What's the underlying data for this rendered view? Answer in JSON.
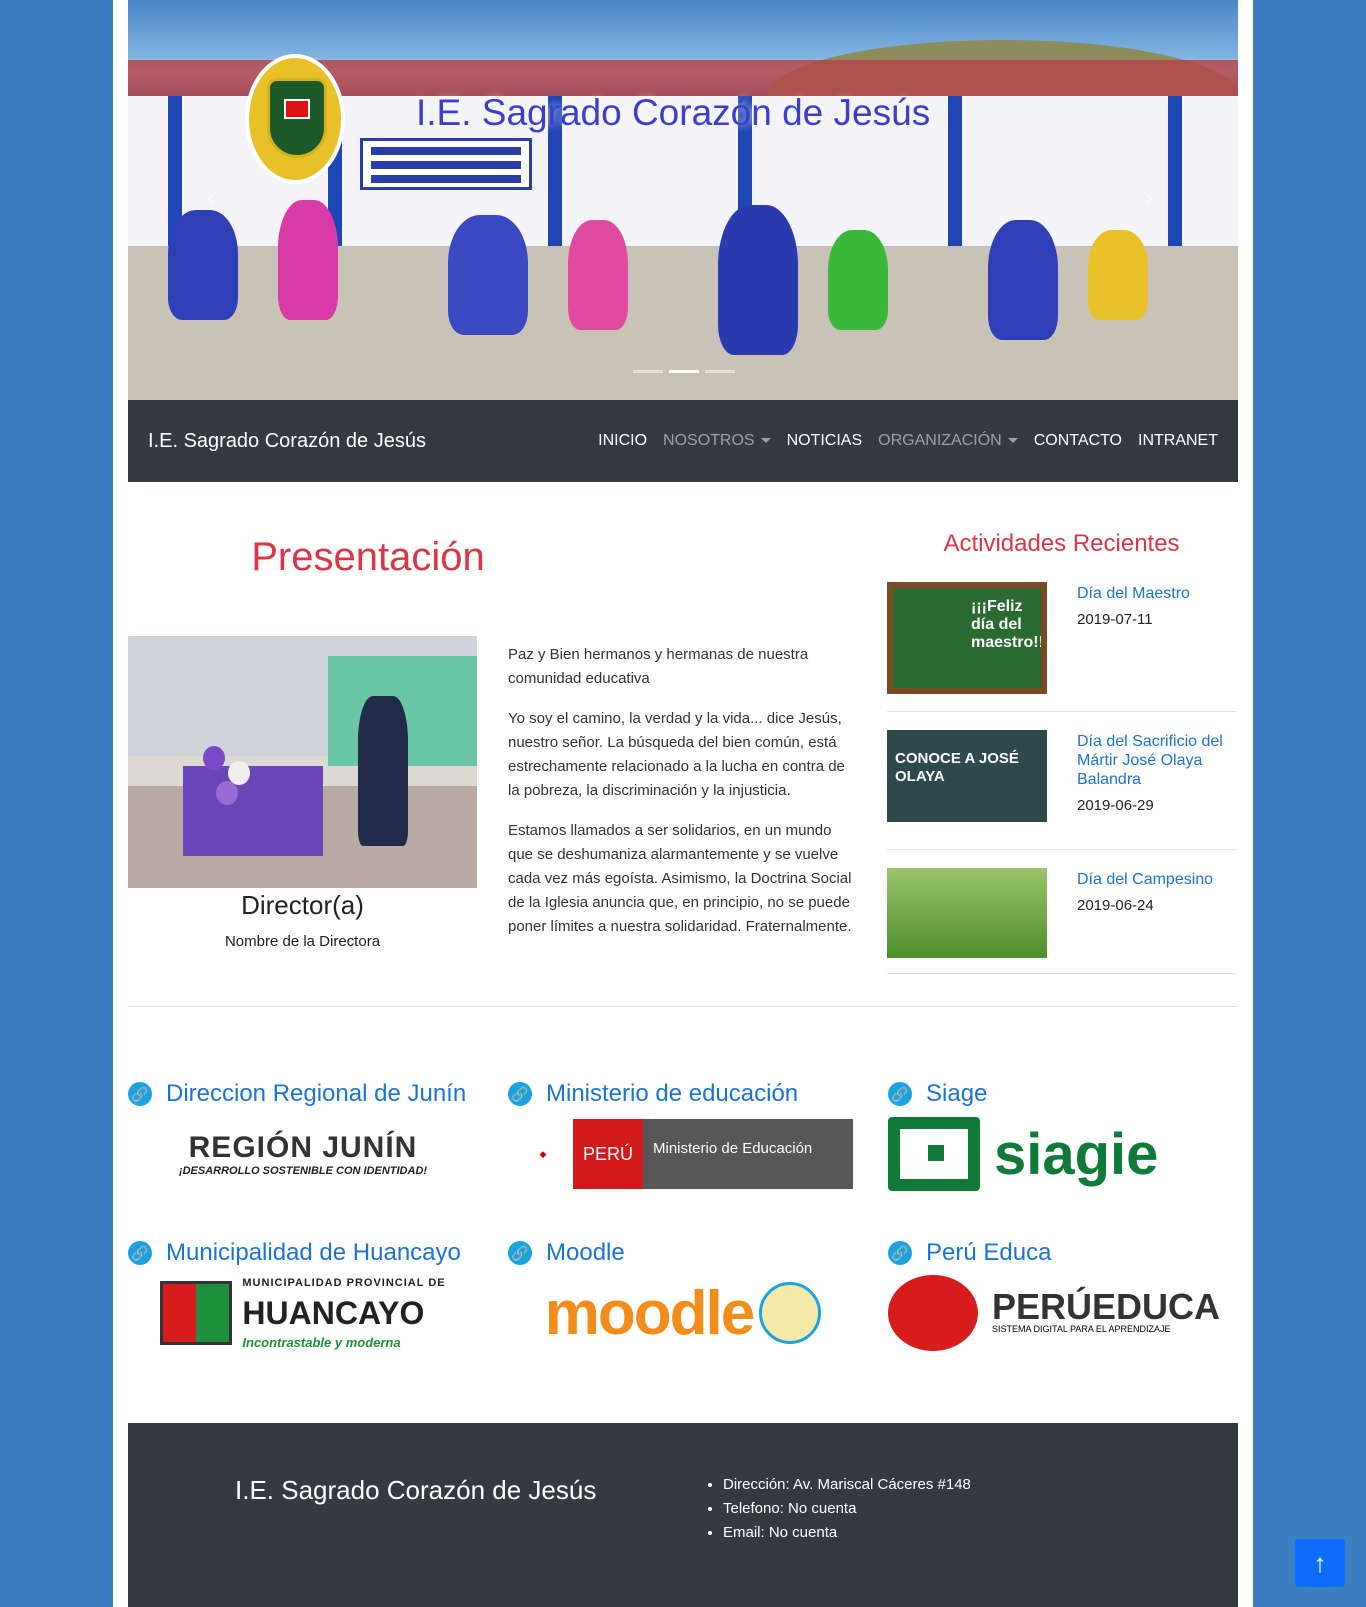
{
  "hero": {
    "title": "I.E. Sagrado Corazón de Jesús",
    "prev": "‹",
    "next": "›",
    "active_slide": 2,
    "slide_count": 3
  },
  "navbar": {
    "brand": "I.E. Sagrado Corazón de Jesús",
    "items": [
      {
        "label": "INICIO"
      },
      {
        "label": "NOSOTROS"
      },
      {
        "label": "NOTICIAS"
      },
      {
        "label": "ORGANIZACIÓN"
      },
      {
        "label": "CONTACTO"
      },
      {
        "label": "INTRANET"
      }
    ]
  },
  "presentation": {
    "title": "Presentación",
    "director_title": "Director(a)",
    "director_name": "Nombre de la Directora",
    "paragraphs": [
      "Paz y Bien hermanos y hermanas de nuestra comunidad educativa",
      "Yo soy el camino, la verdad y la vida... dice Jesús, nuestro señor. La búsqueda del bien común, está estrechamente relacionado a la lucha en contra de la pobreza, la discriminación y la injusticia.",
      "Estamos llamados a ser solidarios, en un mundo que se deshumaniza alarmantemente y se vuelve cada vez más egoísta. Asimismo, la Doctrina Social de la Iglesia anuncia que, en principio, no se puede poner límites a nuestra solidaridad. Fraternalmente."
    ]
  },
  "activities": {
    "title": "Actividades Recientes",
    "items": [
      {
        "title": "Día del Maestro",
        "date": "2019-07-11",
        "thumb_text": "¡¡¡Feliz día del maestro!!!"
      },
      {
        "title": "Día del Sacrificio del Mártir José Olaya Balandra",
        "date": "2019-06-29",
        "thumb_text": "CONOCE A JOSÉ OLAYA"
      },
      {
        "title": "Día del Campesino",
        "date": "2019-06-24",
        "thumb_text": ""
      }
    ]
  },
  "links": [
    {
      "label": "Direccion Regional de Junín",
      "logo_text": "REGIÓN JUNÍN",
      "logo_sub": "¡DESARROLLO SOSTENIBLE CON IDENTIDAD!"
    },
    {
      "label": "Ministerio de educación",
      "logo_text": "PERÚ",
      "logo_sub": "Ministerio de Educación"
    },
    {
      "label": "Siage",
      "logo_text": "siagie",
      "logo_sub": ""
    },
    {
      "label": "Municipalidad de Huancayo",
      "logo_text": "HUANCAYO",
      "logo_sub": "MUNICIPALIDAD PROVINCIAL DE",
      "logo_tag": "Incontrastable y moderna"
    },
    {
      "label": "Moodle",
      "logo_text": "moodle",
      "logo_sub": ""
    },
    {
      "label": "Perú Educa",
      "logo_text": "PERÚEDUCA",
      "logo_sub": "SISTEMA DIGITAL PARA EL APRENDIZAJE"
    }
  ],
  "footer": {
    "title": "I.E. Sagrado Corazón de Jesús",
    "items": [
      "Dirección: Av. Mariscal Cáceres #148",
      "Telefono: No cuenta",
      "Email: No cuenta"
    ]
  },
  "back_to_top": "↑",
  "link_icon": "🔗",
  "colors": {
    "page_bg": "#3b7fc0",
    "nav_bg": "#343a40",
    "heading_red": "#dc3545",
    "link_blue": "#1a73d8",
    "button_blue": "#0d6efd"
  }
}
